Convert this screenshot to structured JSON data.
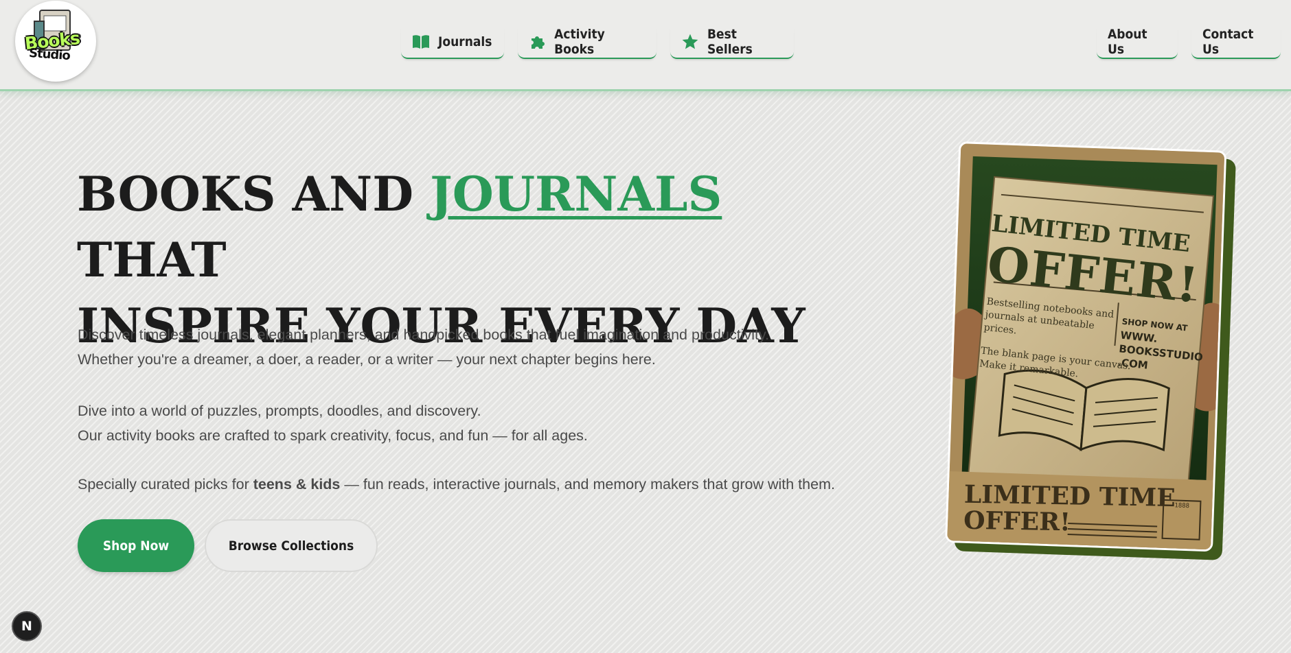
{
  "colors": {
    "accent": "#2a9a58",
    "text": "#1c1c1c",
    "body_text": "#4a4a4a",
    "background": "#e9e9e7"
  },
  "logo": {
    "name_top": "Books",
    "name_bottom": "Studio"
  },
  "nav": {
    "primary": [
      {
        "label": "Journals",
        "icon": "book-icon"
      },
      {
        "label": "Activity Books",
        "icon": "puzzle-icon"
      },
      {
        "label": "Best Sellers",
        "icon": "star-icon"
      }
    ],
    "secondary": [
      {
        "label": "About Us"
      },
      {
        "label": "Contact Us"
      }
    ]
  },
  "hero": {
    "headline_before": "BOOKS AND ",
    "headline_accent": "JOURNALS",
    "headline_after": " THAT",
    "headline_line2": "INSPIRE YOUR EVERY DAY",
    "para1_line1": "Discover timeless journals, elegant planners, and handpicked books that fuel imagination and productivity.",
    "para1_line2": "Whether you're a dreamer, a doer, a reader, or a writer — your next chapter begins here.",
    "para2_line1": "Dive into a world of puzzles, prompts, doodles, and discovery.",
    "para2_line2": "Our activity books are crafted to spark creativity, focus, and fun — for all ages.",
    "para3_before": "Specially curated picks for ",
    "para3_bold": "teens & kids",
    "para3_after": " — fun reads, interactive journals, and memory makers that grow with them.",
    "shop_button": "Shop Now",
    "browse_button": "Browse Collections"
  },
  "promo": {
    "title_line1": "LIMITED TIME",
    "title_line2": "OFFER!",
    "desc_line1": "Bestselling notebooks and",
    "desc_line2": "journals at unbeatable",
    "desc_line3": "prices.",
    "shop_line1": "SHOP NOW AT",
    "shop_line2": "WWW.",
    "shop_line3": "BOOKSSTUDIO",
    "shop_line4": ".COM",
    "tagline_line1": "The blank page is your canvas.",
    "tagline_line2": "Make it remarkable.",
    "bottom_line1": "LIMITED TIME",
    "bottom_line2": "OFFER!",
    "stamp": "1888"
  },
  "dev_badge": "N"
}
